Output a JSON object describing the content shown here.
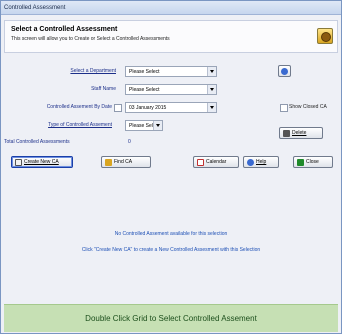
{
  "window": {
    "title": "Controlled Assessment"
  },
  "header": {
    "title": "Select a Controlled Assessment",
    "subtitle": "This screen will allow you to Create or Select a Controlled Assessments"
  },
  "form": {
    "department_label": "Select a Department",
    "department_value": "Please Select",
    "staff_label": "Staff Name",
    "staff_value": "Please Select",
    "date_label": "Controlled Assement By Date",
    "date_value": "03  January  2015",
    "type_label": "Type of Controlled Assement",
    "type_value": "Please Select",
    "total_label": "Total Controlled Assessments",
    "total_value": "0",
    "show_closed_label": "Show Closed CA"
  },
  "buttons": {
    "delete": "Delete",
    "create": "Create New CA",
    "find": "Find CA",
    "calendar": "Calendar",
    "help": "Help",
    "close": "Close"
  },
  "messages": {
    "none": "No Controlled Assement available for this selection",
    "hint": "Click \"Create New CA\" to create a  New Controlled Assesment with this Selection"
  },
  "footer": {
    "text": "Double Click Grid to Select Controlled Assement"
  },
  "colors": {
    "accent": "#1c2f8a",
    "footer_bg": "#c6e0b4"
  }
}
